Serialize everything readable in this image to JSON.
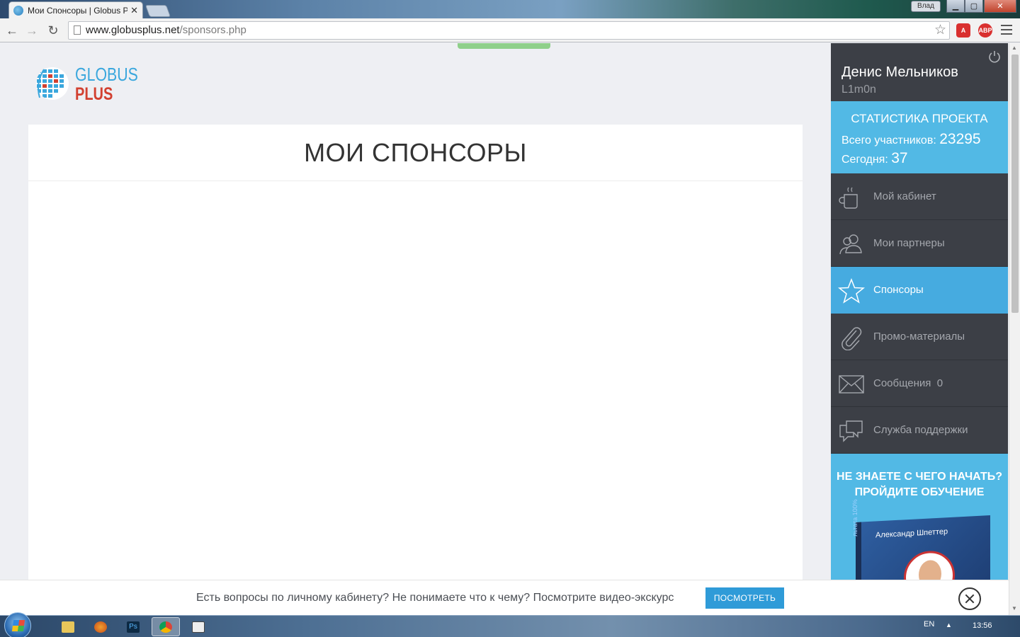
{
  "browser": {
    "tab_title": "Мои Спонсоры | Globus P",
    "tab_close": "✕",
    "profile_label": "Влад",
    "url_host": "www.globusplus.net",
    "url_path": "/sponsors.php",
    "ext_abp": "ABP",
    "ext_other": "A"
  },
  "logo": {
    "line1": "GLOBUS",
    "line2": "PLUS"
  },
  "main": {
    "title": "МОИ СПОНСОРЫ"
  },
  "sidebar": {
    "user_name": "Денис Мельников",
    "user_login": "L1m0n",
    "stats": {
      "title": "СТАТИСТИКА ПРОЕКТА",
      "total_label": "Всего участников:",
      "total_value": "23295",
      "today_label": "Сегодня:",
      "today_value": "37"
    },
    "items": [
      {
        "label": "Мой кабинет",
        "icon": "cup-icon"
      },
      {
        "label": "Мои партнеры",
        "icon": "users-icon"
      },
      {
        "label": "Спонсоры",
        "icon": "star-icon",
        "active": true
      },
      {
        "label": "Промо-материалы",
        "icon": "paperclip-icon"
      },
      {
        "label": "Сообщения",
        "icon": "envelope-icon",
        "count": "0"
      },
      {
        "label": "Служба поддержки",
        "icon": "chat-icon"
      }
    ],
    "promo": {
      "line1": "НЕ ЗНАЕТЕ С ЧЕГО НАЧАТЬ?",
      "line2": "ПРОЙДИТЕ ОБУЧЕНИЕ",
      "author": "Александр Шпеттер",
      "spine": "льтата 100%"
    }
  },
  "tipbar": {
    "text": "Есть вопросы по личному кабинету? Не понимаете что к чему? Посмотрите видео-экскурс",
    "button": "ПОСМОТРЕТЬ"
  },
  "taskbar": {
    "lang": "EN",
    "time": "13:56",
    "ps_label": "Ps"
  },
  "colors": {
    "accent": "#52b9e5",
    "sidebar_bg": "#3c3f46",
    "active_item": "#46abe0",
    "button": "#2f9bd8"
  }
}
